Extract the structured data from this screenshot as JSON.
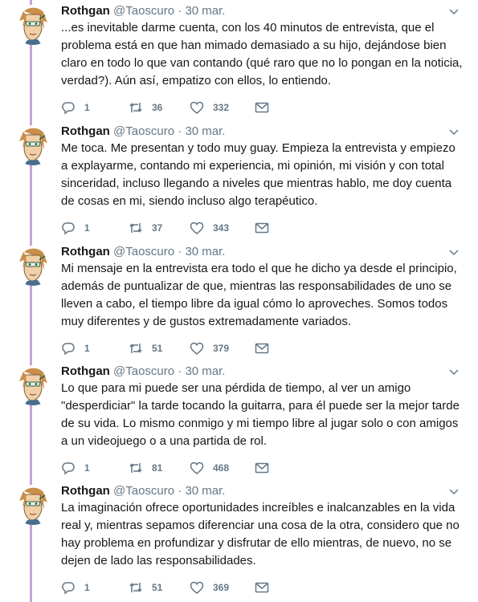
{
  "thread": {
    "author_name": "Rothgan",
    "author_handle": "@Taoscuro",
    "separator": "·",
    "tweets": [
      {
        "date": "30 mar.",
        "text": "...es inevitable darme cuenta, con los 40 minutos de entrevista, que el problema está en que han mimado demasiado a su hijo, dejándose bien claro en todo lo que van contando (qué raro que no lo pongan en la noticia, verdad?). Aún así, empatizo con ellos, lo entiendo.",
        "replies": "1",
        "retweets": "36",
        "likes": "332"
      },
      {
        "date": "30 mar.",
        "text": "Me toca. Me presentan y todo muy guay. Empieza la entrevista y empiezo a explayarme, contando mi experiencia, mi opinión, mi visión y con total sinceridad, incluso llegando a niveles que mientras hablo, me doy cuenta de cosas en mi, siendo incluso algo terapéutico.",
        "replies": "1",
        "retweets": "37",
        "likes": "343"
      },
      {
        "date": "30 mar.",
        "text": "Mi mensaje en la entrevista era todo el que he dicho ya desde el principio, además de puntualizar de que, mientras las responsabilidades de uno se lleven a cabo, el tiempo libre da igual cómo lo aproveches. Somos todos muy diferentes y de gustos extremadamente variados.",
        "replies": "1",
        "retweets": "51",
        "likes": "379"
      },
      {
        "date": "30 mar.",
        "text": "Lo que para mi puede ser una pérdida de tiempo, al ver un amigo \"desperdiciar\" la tarde tocando la guitarra, para él puede ser la mejor tarde de su vida. Lo mismo conmigo y mi tiempo libre al jugar solo o con amigos a un videojuego o a una partida de rol.",
        "replies": "1",
        "retweets": "81",
        "likes": "468"
      },
      {
        "date": "30 mar.",
        "text": "La imaginación ofrece oportunidades increíbles e inalcanzables en la vida real y, mientras sepamos diferenciar una cosa de la otra, considero que no hay problema en profundizar y disfrutar de ello mientras, de nuevo, no se dejen de lado las responsabilidades.",
        "replies": "1",
        "retweets": "51",
        "likes": "369"
      }
    ]
  },
  "icons": {
    "reply": "reply-icon",
    "retweet": "retweet-icon",
    "like": "heart-icon",
    "message": "envelope-icon",
    "menu": "chevron-down-icon"
  },
  "colors": {
    "thread_line": "#c9a3d6",
    "secondary_text": "#657786",
    "icon": "#657786"
  }
}
